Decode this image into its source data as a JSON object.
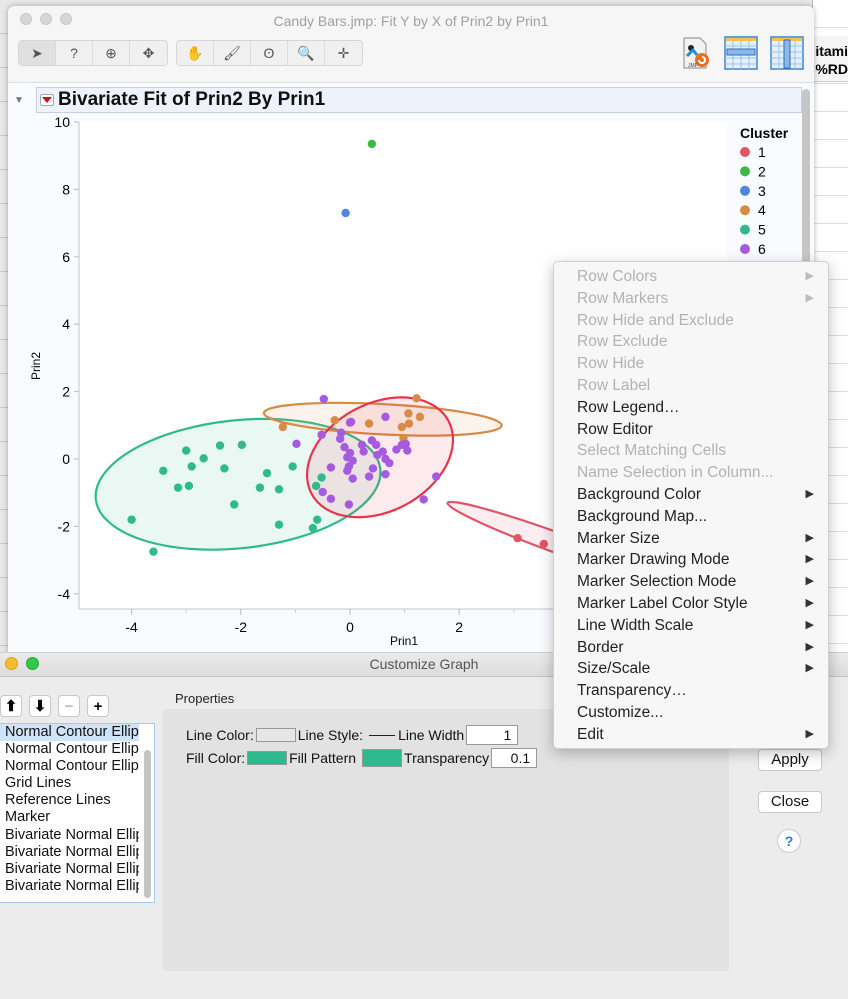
{
  "main_window": {
    "title": "Candy Bars.jmp: Fit Y by X of Prin2 by Prin1",
    "toolbar_left": [
      {
        "name": "arrow-tool",
        "glyph": "➤"
      },
      {
        "name": "help-tool",
        "glyph": "?"
      },
      {
        "name": "selection-tool",
        "glyph": "⊕"
      },
      {
        "name": "move-tool",
        "glyph": "✥"
      }
    ],
    "toolbar_mid": [
      {
        "name": "grabber-tool",
        "glyph": "✋"
      },
      {
        "name": "brush-tool",
        "glyph": "🖌"
      },
      {
        "name": "lasso-tool",
        "glyph": "ʘ"
      },
      {
        "name": "magnifier-tool",
        "glyph": "🔍"
      },
      {
        "name": "crosshair-tool",
        "glyph": "✛"
      }
    ],
    "report_title": "Bivariate Fit of Prin2 By Prin1"
  },
  "background_table": {
    "column_header_line1": "itami",
    "column_header_line2": "%RD"
  },
  "chart_data": {
    "type": "scatter",
    "title": "Bivariate Fit of Prin2 By Prin1",
    "xlabel": "Prin1",
    "ylabel": "Prin2",
    "xlim": [
      -4.9,
      4.5
    ],
    "ylim": [
      -4.4,
      10
    ],
    "xticks": [
      -4,
      -2,
      0,
      2
    ],
    "yticks": [
      10,
      8,
      6,
      4,
      2,
      0,
      -2,
      -4
    ],
    "legend": {
      "title": "Cluster",
      "position": "right",
      "entries": [
        {
          "label": "1",
          "color": "#e05567"
        },
        {
          "label": "2",
          "color": "#3cba44"
        },
        {
          "label": "3",
          "color": "#4f86e0"
        },
        {
          "label": "4",
          "color": "#d98a44"
        },
        {
          "label": "5",
          "color": "#2fba8e"
        },
        {
          "label": "6",
          "color": "#a55ae0"
        }
      ]
    },
    "series": [
      {
        "name": "1",
        "color": "#e05567",
        "points": [
          [
            3.07,
            -2.35
          ],
          [
            3.55,
            -2.52
          ]
        ]
      },
      {
        "name": "2",
        "color": "#3cba44",
        "points": [
          [
            0.4,
            9.35
          ]
        ]
      },
      {
        "name": "3",
        "color": "#4f86e0",
        "points": [
          [
            -0.08,
            7.3
          ]
        ]
      },
      {
        "name": "4",
        "color": "#d98a44",
        "points": [
          [
            -1.23,
            0.95
          ],
          [
            -0.28,
            1.15
          ],
          [
            0.35,
            1.05
          ],
          [
            0.95,
            0.95
          ],
          [
            1.07,
            1.35
          ],
          [
            1.22,
            1.8
          ],
          [
            1.28,
            1.25
          ],
          [
            0.98,
            0.62
          ],
          [
            1.08,
            1.05
          ]
        ]
      },
      {
        "name": "5",
        "color": "#2fba8e",
        "points": [
          [
            -4.0,
            -1.8
          ],
          [
            -3.6,
            -2.75
          ],
          [
            -3.42,
            -0.35
          ],
          [
            -3.15,
            -0.85
          ],
          [
            -2.95,
            -0.8
          ],
          [
            -3.0,
            0.25
          ],
          [
            -2.9,
            -0.22
          ],
          [
            -2.68,
            0.02
          ],
          [
            -2.38,
            0.4
          ],
          [
            -2.3,
            -0.28
          ],
          [
            -1.98,
            0.42
          ],
          [
            -2.12,
            -1.35
          ],
          [
            -1.52,
            -0.42
          ],
          [
            -1.65,
            -0.85
          ],
          [
            -1.3,
            -0.9
          ],
          [
            -1.3,
            -1.95
          ],
          [
            -1.05,
            -0.22
          ],
          [
            -0.6,
            -1.8
          ],
          [
            -0.68,
            -2.05
          ],
          [
            -0.52,
            -0.55
          ],
          [
            -0.62,
            -0.8
          ]
        ]
      },
      {
        "name": "6",
        "color": "#a55ae0",
        "points": [
          [
            -0.48,
            1.78
          ],
          [
            -0.98,
            0.45
          ],
          [
            -0.52,
            0.72
          ],
          [
            -0.16,
            0.78
          ],
          [
            -0.18,
            0.6
          ],
          [
            0.0,
            1.08
          ],
          [
            0.02,
            1.1
          ],
          [
            0.65,
            1.25
          ],
          [
            0.22,
            0.42
          ],
          [
            0.4,
            0.55
          ],
          [
            0.48,
            0.42
          ],
          [
            0.5,
            0.12
          ],
          [
            0.6,
            0.22
          ],
          [
            0.65,
            0.0
          ],
          [
            0.72,
            -0.12
          ],
          [
            0.85,
            0.28
          ],
          [
            0.95,
            0.42
          ],
          [
            1.02,
            0.45
          ],
          [
            1.05,
            0.25
          ],
          [
            -0.05,
            0.05
          ],
          [
            -0.02,
            -0.22
          ],
          [
            0.0,
            0.18
          ],
          [
            0.05,
            -0.05
          ],
          [
            -0.05,
            -0.35
          ],
          [
            -0.1,
            0.35
          ],
          [
            -0.35,
            -0.25
          ],
          [
            0.42,
            -0.28
          ],
          [
            0.35,
            -0.52
          ],
          [
            0.65,
            -0.45
          ],
          [
            0.05,
            -0.58
          ],
          [
            -0.35,
            -1.18
          ],
          [
            -0.5,
            -0.98
          ],
          [
            -0.02,
            -1.35
          ],
          [
            1.35,
            -1.2
          ],
          [
            1.58,
            -0.52
          ],
          [
            0.25,
            0.22
          ]
        ]
      }
    ],
    "ellipses": [
      {
        "cluster": "5",
        "color": "#2fba8e",
        "cx": -2.05,
        "cy": -0.75,
        "rx": 2.62,
        "ry": 1.9,
        "angle_deg": -6
      },
      {
        "cluster": "4",
        "color": "#d98a44",
        "cx": 0.6,
        "cy": 1.18,
        "rx": 2.18,
        "ry": 0.45,
        "angle_deg": 3
      },
      {
        "cluster": "6",
        "color": "#e8334a",
        "cx": 0.55,
        "cy": 0.05,
        "rx": 1.42,
        "ry": 1.6,
        "angle_deg": -28
      },
      {
        "cluster": "1",
        "color": "#e05567",
        "cx": 3.9,
        "cy": -2.55,
        "rx": 2.25,
        "ry": 0.3,
        "angle_deg": 20
      }
    ]
  },
  "context_menu": {
    "items": [
      {
        "label": "Row Colors",
        "enabled": false,
        "submenu": true
      },
      {
        "label": "Row Markers",
        "enabled": false,
        "submenu": true
      },
      {
        "label": "Row Hide and Exclude",
        "enabled": false,
        "submenu": false
      },
      {
        "label": "Row Exclude",
        "enabled": false,
        "submenu": false
      },
      {
        "label": "Row Hide",
        "enabled": false,
        "submenu": false
      },
      {
        "label": "Row Label",
        "enabled": false,
        "submenu": false
      },
      {
        "label": "Row Legend…",
        "enabled": true,
        "submenu": false
      },
      {
        "label": "Row Editor",
        "enabled": true,
        "submenu": false
      },
      {
        "label": "Select Matching Cells",
        "enabled": false,
        "submenu": false
      },
      {
        "label": "Name Selection in Column...",
        "enabled": false,
        "submenu": false
      },
      {
        "label": "Background Color",
        "enabled": true,
        "submenu": true
      },
      {
        "label": "Background Map...",
        "enabled": true,
        "submenu": false
      },
      {
        "label": "Marker Size",
        "enabled": true,
        "submenu": true
      },
      {
        "label": "Marker Drawing Mode",
        "enabled": true,
        "submenu": true
      },
      {
        "label": "Marker Selection Mode",
        "enabled": true,
        "submenu": true
      },
      {
        "label": "Marker Label Color Style",
        "enabled": true,
        "submenu": true
      },
      {
        "label": "Line Width Scale",
        "enabled": true,
        "submenu": true
      },
      {
        "label": "Border",
        "enabled": true,
        "submenu": true
      },
      {
        "label": "Size/Scale",
        "enabled": true,
        "submenu": true
      },
      {
        "label": "Transparency…",
        "enabled": true,
        "submenu": false
      },
      {
        "label": "Customize...",
        "enabled": true,
        "submenu": false
      },
      {
        "label": "Edit",
        "enabled": true,
        "submenu": true
      }
    ]
  },
  "customize_dialog": {
    "title": "Customize Graph",
    "order_buttons": [
      {
        "name": "move-up-button",
        "glyph": "⬆",
        "enabled": true
      },
      {
        "name": "move-down-button",
        "glyph": "⬇",
        "enabled": true
      },
      {
        "name": "remove-button",
        "glyph": "−",
        "enabled": false
      },
      {
        "name": "add-button",
        "glyph": "+",
        "enabled": true
      }
    ],
    "layers": [
      {
        "label": "Normal Contour Ellipse",
        "selected": true
      },
      {
        "label": "Normal Contour Ellipse",
        "selected": false
      },
      {
        "label": "Normal Contour Ellipse",
        "selected": false
      },
      {
        "label": "Grid Lines",
        "selected": false
      },
      {
        "label": "Reference Lines",
        "selected": false
      },
      {
        "label": "Marker",
        "selected": false
      },
      {
        "label": "Bivariate Normal Ellipse",
        "selected": false
      },
      {
        "label": "Bivariate Normal Ellipse",
        "selected": false
      },
      {
        "label": "Bivariate Normal Ellipse",
        "selected": false
      },
      {
        "label": "Bivariate Normal Ellipse",
        "selected": false
      }
    ],
    "properties_label": "Properties",
    "line_color_label": "Line Color:",
    "line_color": "#e6e6e6",
    "line_style_label": "Line Style:",
    "line_width_label": "Line Width",
    "line_width": "1",
    "fill_color_label": "Fill Color:",
    "fill_color": "#2fba8e",
    "fill_pattern_label": "Fill Pattern",
    "fill_pattern_color": "#2fba8e",
    "transparency_label": "Transparency",
    "transparency": "0.1",
    "apply_label": "Apply",
    "close_label": "Close",
    "help_label": "?"
  }
}
